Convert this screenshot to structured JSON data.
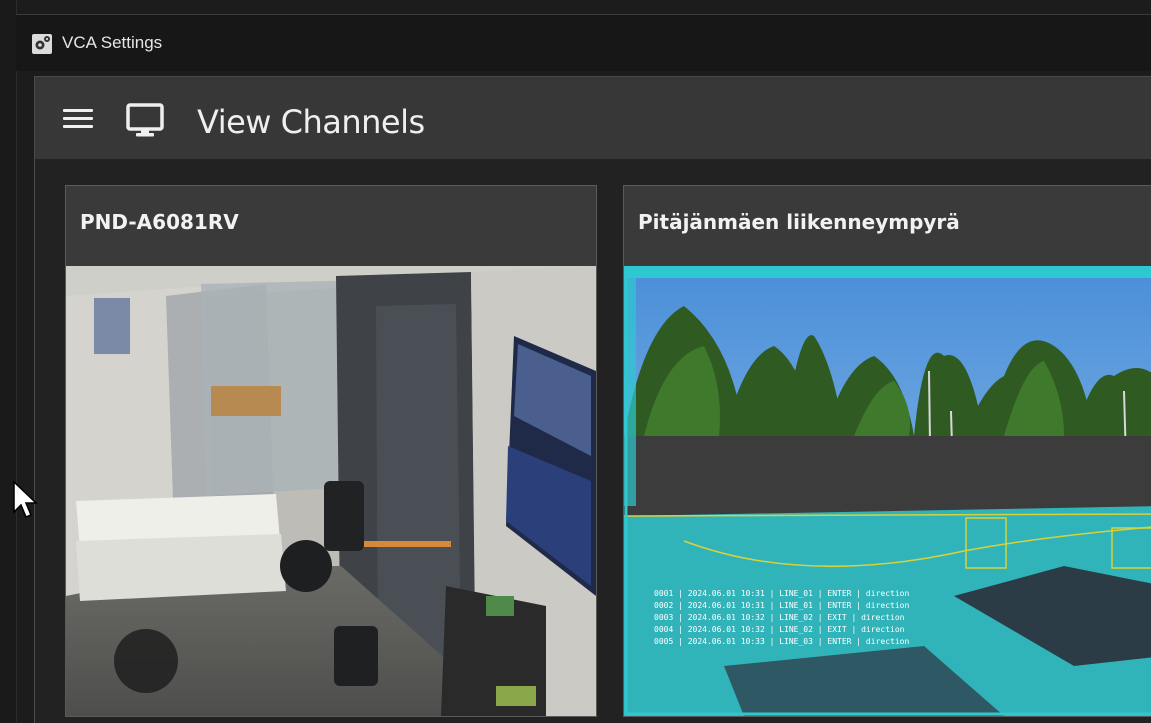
{
  "window": {
    "title": "VCA Settings",
    "icon": "gear-icon"
  },
  "header": {
    "title": "View Channels",
    "menu_icon": "hamburger-menu-icon",
    "view_icon": "monitor-icon"
  },
  "channels": [
    {
      "name": "PND-A6081RV",
      "feed": "camera-feed-office"
    },
    {
      "name": "Pitäjänmäen liikenneympyrä",
      "feed": "camera-feed-roundabout"
    }
  ],
  "colors": {
    "accent_overlay": "#2ec9d0",
    "zone_line": "#d8d23a",
    "header_bg": "#373737",
    "titlebar_bg": "#171717"
  }
}
